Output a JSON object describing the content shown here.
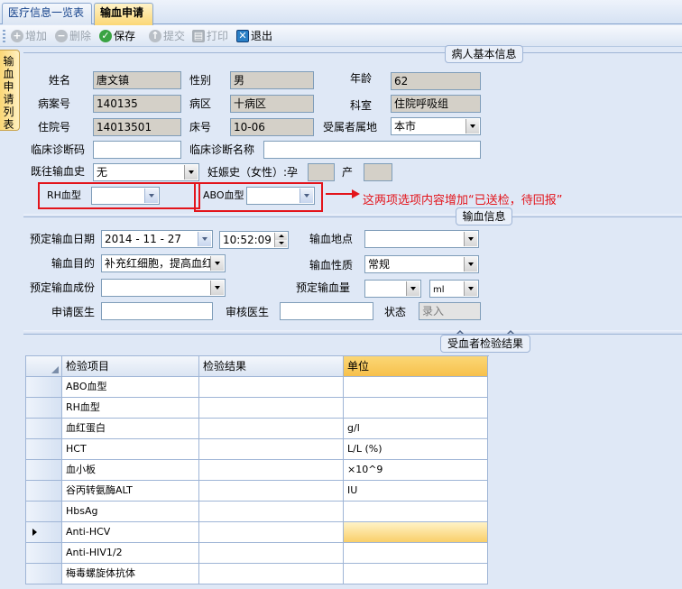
{
  "tabs": [
    {
      "label": "医疗信息一览表"
    },
    {
      "label": "输血申请"
    }
  ],
  "toolbar": {
    "add": "增加",
    "delete": "删除",
    "save": "保存",
    "submit": "提交",
    "print": "打印",
    "exit": "退出"
  },
  "side_tab": "输血申请列表",
  "patient": {
    "title": "病人基本信息",
    "name_label": "姓名",
    "name": "唐文镇",
    "gender_label": "性别",
    "gender": "男",
    "age_label": "年龄",
    "age": "62",
    "record_label": "病案号",
    "record": "140135",
    "ward_label": "病区",
    "ward": "十病区",
    "dept_label": "科室",
    "dept": "住院呼吸组",
    "admission_label": "住院号",
    "admission": "14013501",
    "bed_label": "床号",
    "bed": "10-06",
    "residence_label": "受属者属地",
    "residence": "本市",
    "diag_code_label": "临床诊断码",
    "diag_code": "",
    "diag_name_label": "临床诊断名称",
    "diag_name": "",
    "history_label": "既往输血史",
    "history": "无",
    "pregnancy_label": "妊娠史（女性）:孕",
    "birth_label": "产",
    "rh_label": "RH血型",
    "abo_label": "ABO血型",
    "annotation": "这两项选项内容增加“已送检，待回报”"
  },
  "transfusion": {
    "title": "输血信息",
    "date_label": "预定输血日期",
    "date": "2014 - 11 - 27",
    "time": "10:52:09",
    "place_label": "输血地点",
    "place": "",
    "purpose_label": "输血目的",
    "purpose": "补充红细胞，提高血红",
    "nature_label": "输血性质",
    "nature": "常规",
    "component_label": "预定输血成份",
    "component": "",
    "amount_label": "预定输血量",
    "amount": "",
    "unit": "ml",
    "doctor_label": "申请医生",
    "doctor": "",
    "reviewer_label": "审核医生",
    "reviewer": "",
    "status_label": "状态",
    "status": "录入"
  },
  "results": {
    "title": "受血者检验结果",
    "columns": [
      "检验项目",
      "检验结果",
      "单位"
    ],
    "rows": [
      {
        "item": "ABO血型",
        "result": "",
        "unit": ""
      },
      {
        "item": "RH血型",
        "result": "",
        "unit": ""
      },
      {
        "item": "血红蛋白",
        "result": "",
        "unit": "g/l"
      },
      {
        "item": "HCT",
        "result": "",
        "unit": "L/L (%)"
      },
      {
        "item": "血小板",
        "result": "",
        "unit": "×10^9"
      },
      {
        "item": "谷丙转氨酶ALT",
        "result": "",
        "unit": "IU"
      },
      {
        "item": "HbsAg",
        "result": "",
        "unit": ""
      },
      {
        "item": "Anti-HCV",
        "result": "",
        "unit": ""
      },
      {
        "item": "Anti-HIV1/2",
        "result": "",
        "unit": ""
      },
      {
        "item": "梅毒螺旋体抗体",
        "result": "",
        "unit": ""
      }
    ]
  },
  "colors": {
    "accent": "#fbd776",
    "frame": "#9fb5d6",
    "background": "#dfe8f6",
    "annotation": "#e3141b"
  }
}
